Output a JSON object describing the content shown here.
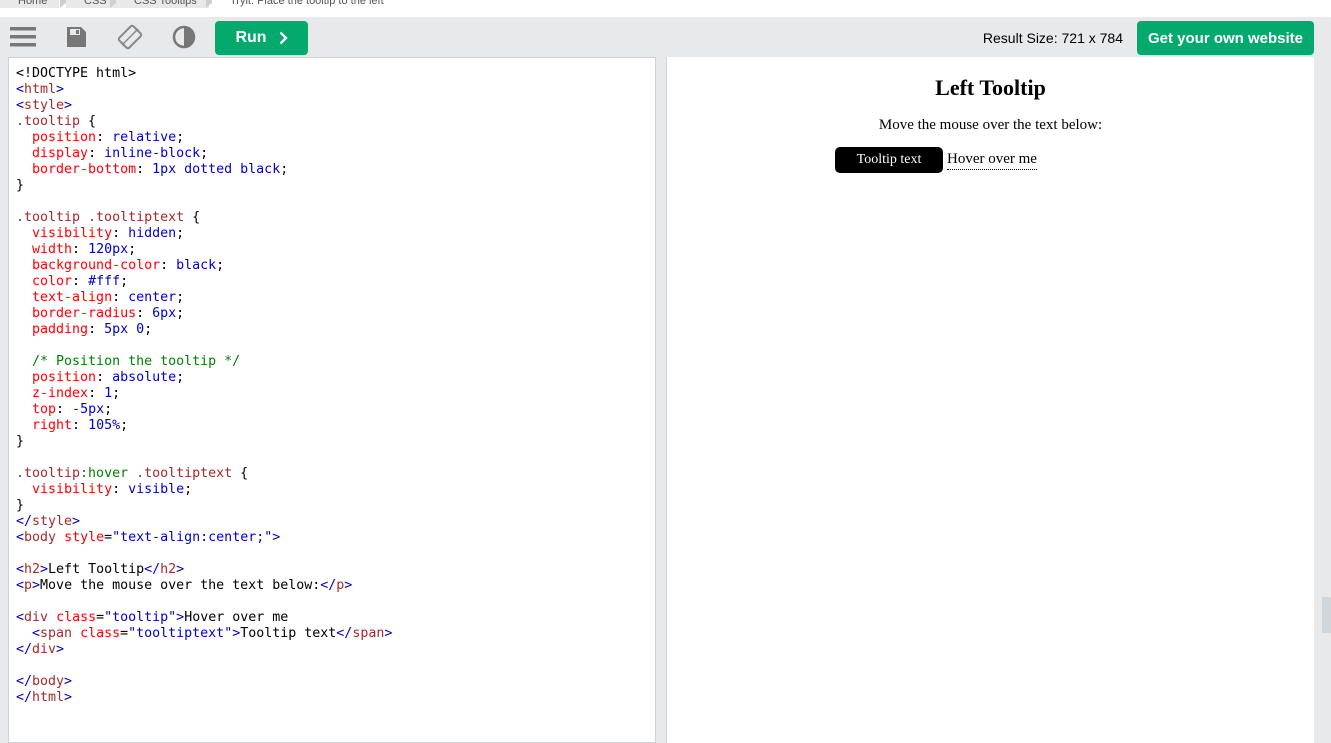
{
  "breadcrumbs": [
    "Home",
    "CSS",
    "CSS Tooltips",
    "Tryit: Place the tooltip to the left"
  ],
  "toolbar": {
    "icons": [
      "menu-icon",
      "save-icon",
      "rotate-icon",
      "contrast-icon"
    ],
    "run_label": "Run",
    "result_size": "Result Size: 721 x 784",
    "own_website_label": "Get your own website"
  },
  "colors": {
    "accent": "#04aa6d",
    "toolbar_bg": "#e7e9eb"
  },
  "code_lines": [
    [
      [
        "c-text",
        "<!DOCTYPE html>"
      ]
    ],
    [
      [
        "c-tag",
        "<"
      ],
      [
        "c-tagname",
        "html"
      ],
      [
        "c-tag",
        ">"
      ]
    ],
    [
      [
        "c-tag",
        "<"
      ],
      [
        "c-tagname",
        "style"
      ],
      [
        "c-tag",
        ">"
      ]
    ],
    [
      [
        "c-sel",
        ".tooltip"
      ],
      [
        "c-text",
        " {"
      ]
    ],
    [
      [
        "c-text",
        "  "
      ],
      [
        "c-prop",
        "position"
      ],
      [
        "c-text",
        ": "
      ],
      [
        "c-pv",
        "relative"
      ],
      [
        "c-text",
        ";"
      ]
    ],
    [
      [
        "c-text",
        "  "
      ],
      [
        "c-prop",
        "display"
      ],
      [
        "c-text",
        ": "
      ],
      [
        "c-pv",
        "inline-block"
      ],
      [
        "c-text",
        ";"
      ]
    ],
    [
      [
        "c-text",
        "  "
      ],
      [
        "c-prop",
        "border-bottom"
      ],
      [
        "c-text",
        ": "
      ],
      [
        "c-pv",
        "1px dotted black"
      ],
      [
        "c-text",
        ";"
      ]
    ],
    [
      [
        "c-text",
        "}"
      ]
    ],
    [
      [
        "c-text",
        ""
      ]
    ],
    [
      [
        "c-sel",
        ".tooltip .tooltiptext"
      ],
      [
        "c-text",
        " {"
      ]
    ],
    [
      [
        "c-text",
        "  "
      ],
      [
        "c-prop",
        "visibility"
      ],
      [
        "c-text",
        ": "
      ],
      [
        "c-pv",
        "hidden"
      ],
      [
        "c-text",
        ";"
      ]
    ],
    [
      [
        "c-text",
        "  "
      ],
      [
        "c-prop",
        "width"
      ],
      [
        "c-text",
        ": "
      ],
      [
        "c-pv",
        "120px"
      ],
      [
        "c-text",
        ";"
      ]
    ],
    [
      [
        "c-text",
        "  "
      ],
      [
        "c-prop",
        "background-color"
      ],
      [
        "c-text",
        ": "
      ],
      [
        "c-pv",
        "black"
      ],
      [
        "c-text",
        ";"
      ]
    ],
    [
      [
        "c-text",
        "  "
      ],
      [
        "c-prop",
        "color"
      ],
      [
        "c-text",
        ": "
      ],
      [
        "c-pv",
        "#fff"
      ],
      [
        "c-text",
        ";"
      ]
    ],
    [
      [
        "c-text",
        "  "
      ],
      [
        "c-prop",
        "text-align"
      ],
      [
        "c-text",
        ": "
      ],
      [
        "c-pv",
        "center"
      ],
      [
        "c-text",
        ";"
      ]
    ],
    [
      [
        "c-text",
        "  "
      ],
      [
        "c-prop",
        "border-radius"
      ],
      [
        "c-text",
        ": "
      ],
      [
        "c-pv",
        "6px"
      ],
      [
        "c-text",
        ";"
      ]
    ],
    [
      [
        "c-text",
        "  "
      ],
      [
        "c-prop",
        "padding"
      ],
      [
        "c-text",
        ": "
      ],
      [
        "c-pv",
        "5px 0"
      ],
      [
        "c-text",
        ";"
      ]
    ],
    [
      [
        "c-text",
        ""
      ]
    ],
    [
      [
        "c-text",
        "  "
      ],
      [
        "c-comment",
        "/* Position the tooltip */"
      ]
    ],
    [
      [
        "c-text",
        "  "
      ],
      [
        "c-prop",
        "position"
      ],
      [
        "c-text",
        ": "
      ],
      [
        "c-pv",
        "absolute"
      ],
      [
        "c-text",
        ";"
      ]
    ],
    [
      [
        "c-text",
        "  "
      ],
      [
        "c-prop",
        "z-index"
      ],
      [
        "c-text",
        ": "
      ],
      [
        "c-pv",
        "1"
      ],
      [
        "c-text",
        ";"
      ]
    ],
    [
      [
        "c-text",
        "  "
      ],
      [
        "c-prop",
        "top"
      ],
      [
        "c-text",
        ": "
      ],
      [
        "c-pv",
        "-5px"
      ],
      [
        "c-text",
        ";"
      ]
    ],
    [
      [
        "c-text",
        "  "
      ],
      [
        "c-prop",
        "right"
      ],
      [
        "c-text",
        ": "
      ],
      [
        "c-pv",
        "105%"
      ],
      [
        "c-text",
        ";"
      ]
    ],
    [
      [
        "c-text",
        "}"
      ]
    ],
    [
      [
        "c-text",
        ""
      ]
    ],
    [
      [
        "c-sel",
        ".tooltip"
      ],
      [
        "c-pseudo",
        ":hover"
      ],
      [
        "c-sel",
        " .tooltiptext"
      ],
      [
        "c-text",
        " {"
      ]
    ],
    [
      [
        "c-text",
        "  "
      ],
      [
        "c-prop",
        "visibility"
      ],
      [
        "c-text",
        ": "
      ],
      [
        "c-pv",
        "visible"
      ],
      [
        "c-text",
        ";"
      ]
    ],
    [
      [
        "c-text",
        "}"
      ]
    ],
    [
      [
        "c-tag",
        "</"
      ],
      [
        "c-tagname",
        "style"
      ],
      [
        "c-tag",
        ">"
      ]
    ],
    [
      [
        "c-tag",
        "<"
      ],
      [
        "c-tagname",
        "body"
      ],
      [
        "c-text",
        " "
      ],
      [
        "c-attr",
        "style"
      ],
      [
        "c-text",
        "="
      ],
      [
        "c-val",
        "\"text-align:center;\""
      ],
      [
        "c-tag",
        ">"
      ]
    ],
    [
      [
        "c-text",
        ""
      ]
    ],
    [
      [
        "c-tag",
        "<"
      ],
      [
        "c-tagname",
        "h2"
      ],
      [
        "c-tag",
        ">"
      ],
      [
        "c-text",
        "Left Tooltip"
      ],
      [
        "c-tag",
        "</"
      ],
      [
        "c-tagname",
        "h2"
      ],
      [
        "c-tag",
        ">"
      ]
    ],
    [
      [
        "c-tag",
        "<"
      ],
      [
        "c-tagname",
        "p"
      ],
      [
        "c-tag",
        ">"
      ],
      [
        "c-text",
        "Move the mouse over the text below:"
      ],
      [
        "c-tag",
        "</"
      ],
      [
        "c-tagname",
        "p"
      ],
      [
        "c-tag",
        ">"
      ]
    ],
    [
      [
        "c-text",
        ""
      ]
    ],
    [
      [
        "c-tag",
        "<"
      ],
      [
        "c-tagname",
        "div"
      ],
      [
        "c-text",
        " "
      ],
      [
        "c-attr",
        "class"
      ],
      [
        "c-text",
        "="
      ],
      [
        "c-val",
        "\"tooltip\""
      ],
      [
        "c-tag",
        ">"
      ],
      [
        "c-text",
        "Hover over me"
      ]
    ],
    [
      [
        "c-text",
        "  "
      ],
      [
        "c-tag",
        "<"
      ],
      [
        "c-tagname",
        "span"
      ],
      [
        "c-text",
        " "
      ],
      [
        "c-attr",
        "class"
      ],
      [
        "c-text",
        "="
      ],
      [
        "c-val",
        "\"tooltiptext\""
      ],
      [
        "c-tag",
        ">"
      ],
      [
        "c-text",
        "Tooltip text"
      ],
      [
        "c-tag",
        "</"
      ],
      [
        "c-tagname",
        "span"
      ],
      [
        "c-tag",
        ">"
      ]
    ],
    [
      [
        "c-tag",
        "</"
      ],
      [
        "c-tagname",
        "div"
      ],
      [
        "c-tag",
        ">"
      ]
    ],
    [
      [
        "c-text",
        ""
      ]
    ],
    [
      [
        "c-tag",
        "</"
      ],
      [
        "c-tagname",
        "body"
      ],
      [
        "c-tag",
        ">"
      ]
    ],
    [
      [
        "c-tag",
        "</"
      ],
      [
        "c-tagname",
        "html"
      ],
      [
        "c-tag",
        ">"
      ]
    ]
  ],
  "result": {
    "title": "Left Tooltip",
    "paragraph": "Move the mouse over the text below:",
    "tooltip_text": "Tooltip text",
    "hover_text": "Hover over me"
  }
}
